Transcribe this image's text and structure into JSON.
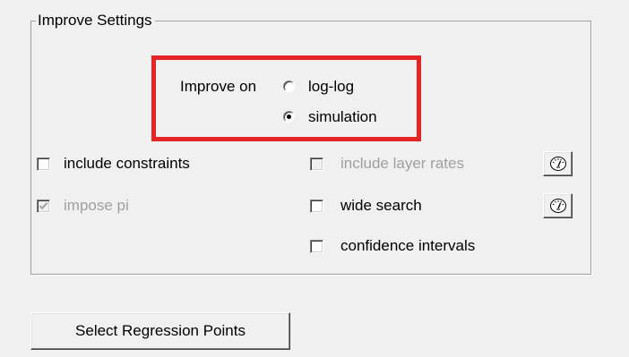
{
  "improve_settings": {
    "group_label": "Improve Settings",
    "improve_on": {
      "label": "Improve on",
      "options": [
        {
          "label": "log-log",
          "selected": false
        },
        {
          "label": "simulation",
          "selected": true
        }
      ]
    },
    "checkboxes": {
      "include_constraints": {
        "label": "include constraints",
        "checked": false,
        "enabled": true
      },
      "impose_pi": {
        "label": "impose pi",
        "checked": true,
        "enabled": false
      },
      "include_layer_rates": {
        "label": "include layer rates",
        "checked": false,
        "enabled": false
      },
      "wide_search": {
        "label": "wide search",
        "checked": false,
        "enabled": true
      },
      "confidence_intervals": {
        "label": "confidence intervals",
        "checked": false,
        "enabled": true
      }
    },
    "icon_buttons": [
      "gauge-icon",
      "gauge-icon"
    ]
  },
  "select_regression_points_button": {
    "label": "Select Regression Points"
  },
  "colors": {
    "background": "#f0f0f0",
    "highlight_border": "#e52425",
    "disabled_text": "#a0a0a0"
  }
}
